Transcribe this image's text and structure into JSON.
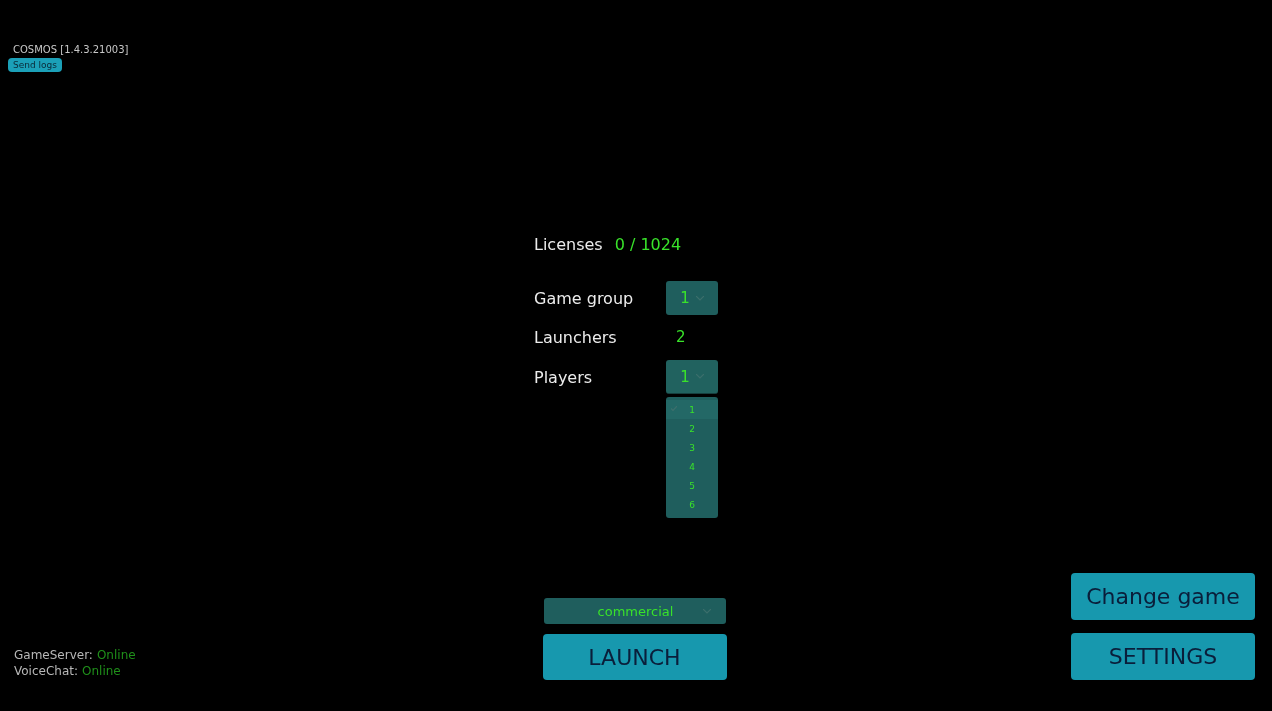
{
  "header": {
    "title": "COSMOS [1.4.3.21003]",
    "send_logs_button": "Send logs"
  },
  "form": {
    "licenses": {
      "label": "Licenses",
      "value": "0 / 1024"
    },
    "game_group": {
      "label": "Game group",
      "value": "1",
      "expanded": false
    },
    "launchers": {
      "label": "Launchers",
      "value": "2"
    },
    "players": {
      "label": "Players",
      "value": "1",
      "expanded": true,
      "options": [
        {
          "label": "1",
          "selected": true
        },
        {
          "label": "2",
          "selected": false
        },
        {
          "label": "3",
          "selected": false
        },
        {
          "label": "4",
          "selected": false
        },
        {
          "label": "5",
          "selected": false
        },
        {
          "label": "6",
          "selected": false
        }
      ]
    }
  },
  "mode_dropdown": {
    "value": "commercial"
  },
  "launch_button": "LAUNCH",
  "status": [
    {
      "label": "GameServer:",
      "value": "Online"
    },
    {
      "label": "VoiceChat:",
      "value": "Online"
    }
  ],
  "buttons": [
    "Change game",
    "SETTINGS"
  ]
}
